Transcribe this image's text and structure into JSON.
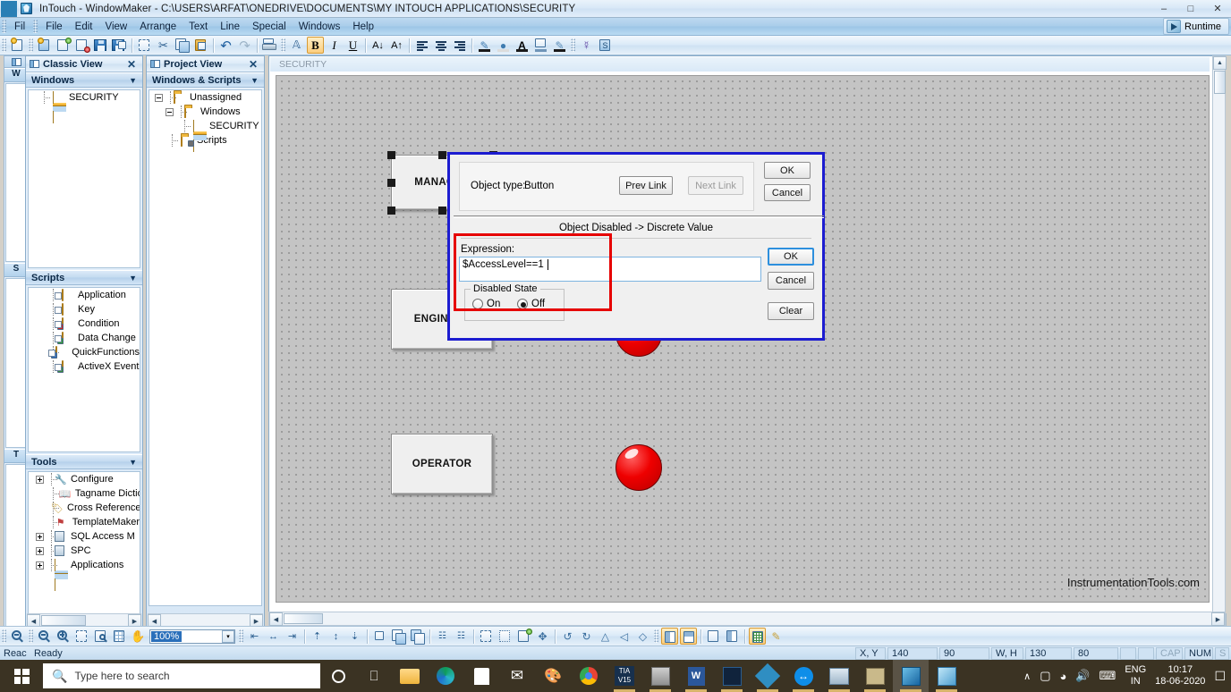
{
  "window": {
    "title": "InTouch - WindowMaker - C:\\USERS\\ARFAT\\ONEDRIVE\\DOCUMENTS\\MY INTOUCH APPLICATIONS\\SECURITY",
    "minimize": "–",
    "maximize": "□",
    "close": "✕"
  },
  "menu": {
    "items": [
      "File",
      "Edit",
      "View",
      "Arrange",
      "Text",
      "Line",
      "Special",
      "Windows",
      "Help"
    ],
    "collapsed_item": "Fil",
    "runtime_label": "Runtime"
  },
  "toolbar": {
    "file_group": [
      "new-window-icon",
      "open-window-icon",
      "duplicate-window-icon",
      "delete-window-icon",
      "save-icon",
      "save-all-icon"
    ],
    "edit_group": [
      "select-all-icon",
      "cut-icon",
      "copy-icon",
      "paste-icon",
      "undo-icon",
      "redo-icon",
      "print-icon"
    ],
    "format_group": [
      "font-icon",
      "bold-icon",
      "italic-icon",
      "underline-icon",
      "decrease-font-icon",
      "increase-font-icon",
      "align-left-icon",
      "align-center-icon",
      "align-right-icon",
      "line-color-icon",
      "fill-color-icon",
      "text-color-icon",
      "window-color-icon",
      "highlight-color-icon"
    ],
    "wizard_group": [
      "wizard-icon",
      "symbol-factory-icon"
    ],
    "bold_label": "B",
    "italic_label": "I",
    "underline_label": "U"
  },
  "classic_view": {
    "title": "Classic View",
    "close": "✕",
    "windows_section": {
      "label": "Windows",
      "caret": "▼",
      "items": [
        {
          "label": "SECURITY",
          "icon": "window-icon"
        }
      ]
    },
    "scripts_section": {
      "label": "Scripts",
      "caret": "▼",
      "items": [
        {
          "label": "Application",
          "icon": "application-script-icon"
        },
        {
          "label": "Key",
          "icon": "key-script-icon"
        },
        {
          "label": "Condition",
          "icon": "condition-script-icon"
        },
        {
          "label": "Data Change",
          "icon": "data-change-script-icon"
        },
        {
          "label": "QuickFunctions",
          "icon": "quickfunctions-script-icon"
        },
        {
          "label": "ActiveX Event",
          "icon": "activex-event-script-icon"
        }
      ]
    },
    "tools_section": {
      "label": "Tools",
      "caret": "▼",
      "items": [
        {
          "label": "Configure",
          "icon": "configure-icon",
          "expandable": true
        },
        {
          "label": "Tagname Dictionary",
          "icon": "tagname-dictionary-icon",
          "expandable": false
        },
        {
          "label": "Cross Reference",
          "icon": "cross-reference-icon",
          "expandable": false
        },
        {
          "label": "TemplateMaker",
          "icon": "template-maker-icon",
          "expandable": false
        },
        {
          "label": "SQL Access Manager",
          "icon": "sql-access-manager-icon",
          "expandable": true
        },
        {
          "label": "SPC",
          "icon": "spc-icon",
          "expandable": true
        },
        {
          "label": "Applications",
          "icon": "applications-icon",
          "expandable": true
        }
      ]
    }
  },
  "project_view": {
    "title": "Project View",
    "close": "✕",
    "section_label": "Windows & Scripts",
    "caret": "▼",
    "tree": [
      {
        "label": "Unassigned",
        "icon": "folder-open-icon",
        "depth": 0,
        "expander": "minus"
      },
      {
        "label": "Windows",
        "icon": "folder-open-icon",
        "depth": 1,
        "expander": "minus"
      },
      {
        "label": "SECURITY",
        "icon": "window-icon",
        "depth": 2,
        "expander": "none"
      },
      {
        "label": "Scripts",
        "icon": "scripts-folder-icon",
        "depth": 1,
        "expander": "none"
      }
    ]
  },
  "canvas": {
    "caption": "SECURITY",
    "watermark": "InstrumentationTools.com",
    "objects": [
      {
        "label": "MANAGER",
        "selected": true
      },
      {
        "label": "ENGINEER",
        "selected": false
      },
      {
        "label": "OPERATOR",
        "selected": false
      }
    ],
    "lamp_color": "#ee0000"
  },
  "dialog": {
    "object_type_label": "Object type:",
    "object_type_value": "Button",
    "prev_link": "Prev Link",
    "next_link": "Next Link",
    "ok": "OK",
    "cancel": "Cancel",
    "section_title": "Object Disabled -> Discrete Value",
    "expression_label": "Expression:",
    "expression_value": "$AccessLevel==1",
    "disabled_state_label": "Disabled State",
    "state_on": "On",
    "state_off": "Off",
    "selected_state": "Off",
    "inner_ok": "OK",
    "inner_cancel": "Cancel",
    "inner_clear": "Clear",
    "highlight_color": "#e60000",
    "border_color": "#1c1cd0"
  },
  "bottom_toolbar": {
    "zoom_value": "100%",
    "zoom_dropdown": "▾",
    "view_group": [
      "zoom-out-icon",
      "zoom-minus-icon",
      "zoom-plus-icon",
      "fit-window-icon",
      "zoom-selection-icon",
      "grid-view-icon",
      "pan-hand-icon"
    ],
    "align_group": [
      "align-left-icon",
      "align-center-icon",
      "align-right-icon",
      "align-top-icon",
      "align-middle-icon",
      "align-bottom-icon",
      "center-icon",
      "bring-front-icon",
      "send-back-icon",
      "space-horizontal-icon",
      "space-vertical-icon",
      "group-icon",
      "ungroup-icon",
      "merge-icon",
      "break-icon",
      "rotate-left-icon",
      "rotate-right-icon",
      "flip-horizontal-icon",
      "flip-vertical-icon",
      "reshape-icon"
    ],
    "right_group": [
      "split-vertical-icon",
      "split-horizontal-icon",
      "single-pane-icon",
      "four-pane-icon",
      "grid-toggle-icon",
      "ruler-icon"
    ]
  },
  "statusbar": {
    "left_hidden": "Reac",
    "ready": "Ready",
    "xy_label": "X, Y",
    "x_value": "140",
    "y_value": "90",
    "wh_label": "W, H",
    "w_value": "130",
    "h_value": "80",
    "cap": "CAP",
    "num": "NUM",
    "scrl": "S"
  },
  "taskbar": {
    "search_placeholder": "Type here to search",
    "search_icon": "search-icon",
    "start_icon": "windows-start-icon",
    "cortana_icon": "cortana-circle-icon",
    "taskview_icon": "task-view-icon",
    "apps": [
      {
        "name": "file-explorer-icon"
      },
      {
        "name": "microsoft-edge-icon"
      },
      {
        "name": "microsoft-store-icon"
      },
      {
        "name": "mail-icon"
      },
      {
        "name": "paint-icon"
      },
      {
        "name": "google-chrome-icon"
      },
      {
        "name": "tia-portal-v15-icon",
        "label": "TIA V15"
      },
      {
        "name": "tool-icon"
      },
      {
        "name": "microsoft-word-icon",
        "label": "W"
      },
      {
        "name": "wonderware-chart-icon"
      },
      {
        "name": "automation-studio-icon"
      },
      {
        "name": "teamviewer-icon"
      },
      {
        "name": "remote-desktop-icon"
      },
      {
        "name": "plc-tool-icon"
      },
      {
        "name": "intouch-windowmaker-icon"
      },
      {
        "name": "intouch-viewer-icon"
      }
    ],
    "tray": {
      "chevron": "∧",
      "icons": [
        "battery-icon",
        "wifi-icon",
        "volume-icon",
        "keyboard-icon"
      ],
      "language_1": "ENG",
      "language_2": "IN",
      "time": "10:17",
      "date": "18-06-2020",
      "action_center": "notification-icon"
    }
  }
}
